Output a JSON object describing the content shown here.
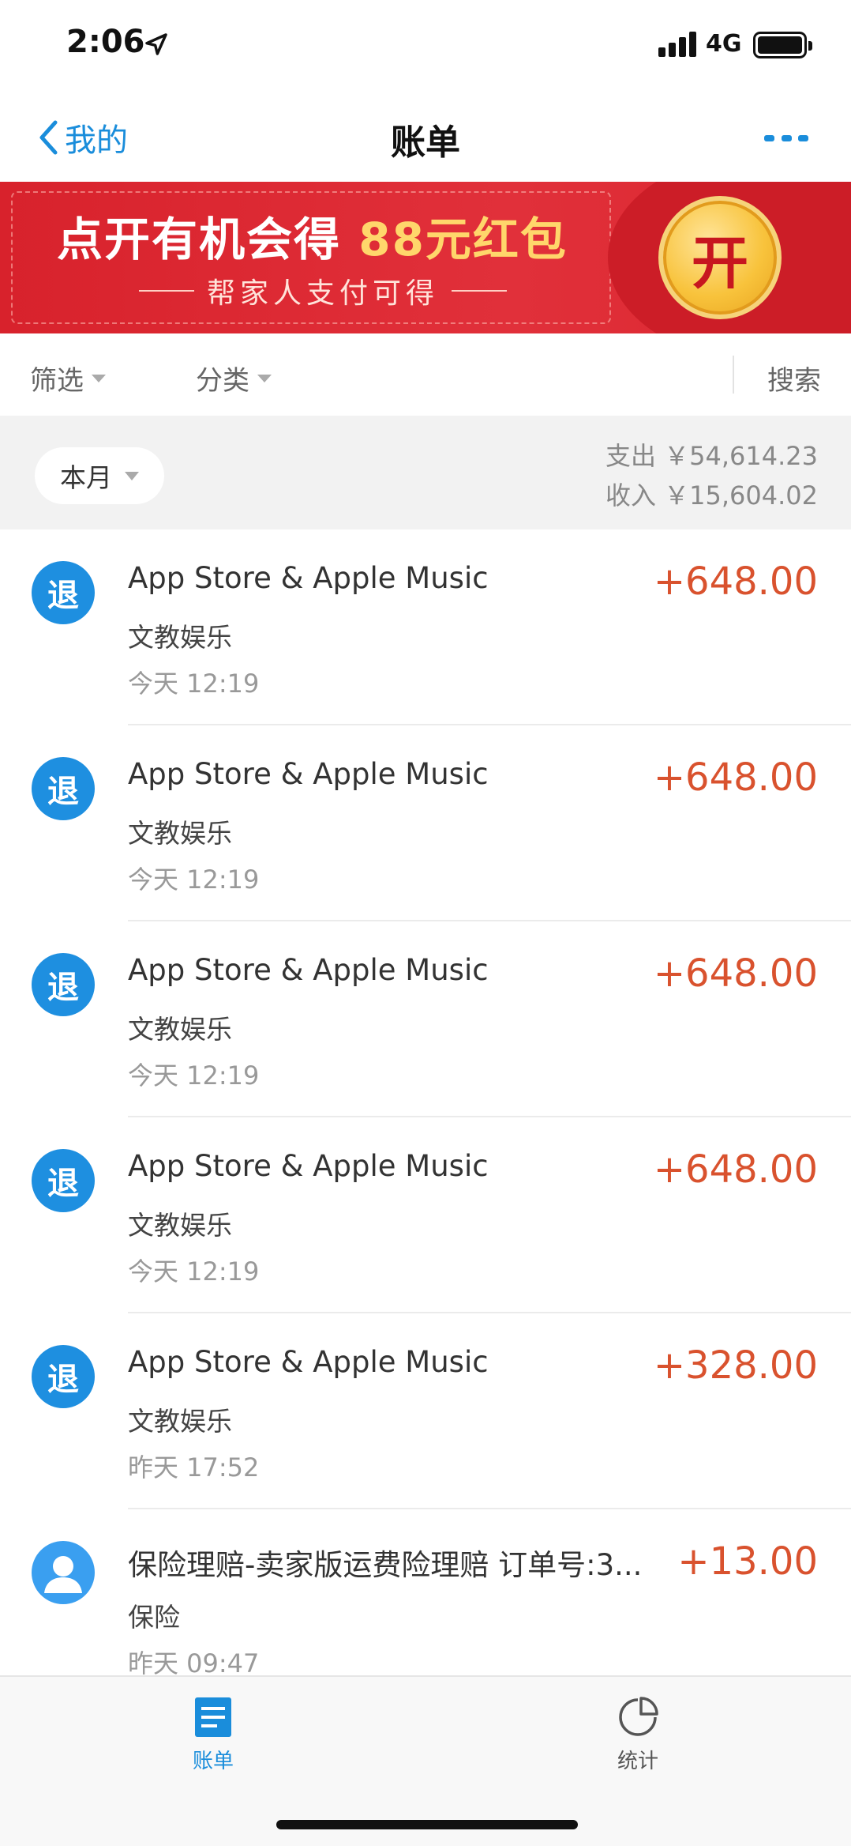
{
  "status_bar": {
    "time": "2:06",
    "network": "4G"
  },
  "nav": {
    "back_label": "我的",
    "title": "账单"
  },
  "banner": {
    "main_text": "点开有机会得",
    "highlight_text": "88元红包",
    "sub_text": "帮家人支付可得",
    "coin_label": "开"
  },
  "filters": {
    "filter_label": "筛选",
    "category_label": "分类",
    "search_label": "搜索"
  },
  "summary": {
    "period": "本月",
    "expense": "支出 ￥54,614.23",
    "income": "收入 ￥15,604.02"
  },
  "transactions": [
    {
      "icon": "退",
      "title": "App Store & Apple Music",
      "category": "文教娱乐",
      "time": "今天  12:19",
      "amount": "+648.00"
    },
    {
      "icon": "退",
      "title": "App Store & Apple Music",
      "category": "文教娱乐",
      "time": "今天  12:19",
      "amount": "+648.00"
    },
    {
      "icon": "退",
      "title": "App Store & Apple Music",
      "category": "文教娱乐",
      "time": "今天  12:19",
      "amount": "+648.00"
    },
    {
      "icon": "退",
      "title": "App Store & Apple Music",
      "category": "文教娱乐",
      "time": "今天  12:19",
      "amount": "+648.00"
    },
    {
      "icon": "退",
      "title": "App Store & Apple Music",
      "category": "文教娱乐",
      "time": "昨天  17:52",
      "amount": "+328.00"
    },
    {
      "icon": "person-icon",
      "title": "保险理赔-卖家版运费险理赔 订单号:3...",
      "category": "保险",
      "time": "昨天  09:47",
      "amount": "+13.00"
    }
  ],
  "tabs": [
    {
      "label": "账单",
      "icon": "bill-icon",
      "active": true
    },
    {
      "label": "统计",
      "icon": "pie-chart-icon",
      "active": false
    }
  ],
  "colors": {
    "accent": "#1a8ddb",
    "amount": "#d9522e",
    "banner": "#d8222c",
    "gold": "#ffd66b"
  }
}
